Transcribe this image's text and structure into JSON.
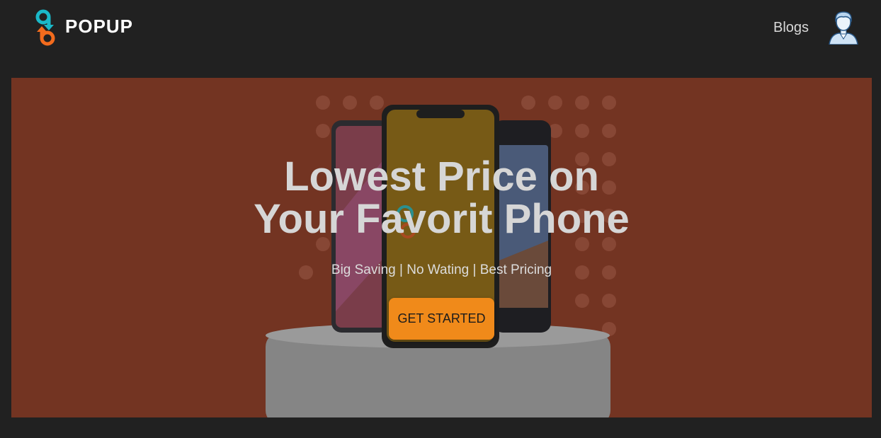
{
  "brand": {
    "name": "POPUP",
    "colors": {
      "primary": "#1ab8c8",
      "secondary": "#f26b1d"
    }
  },
  "nav": {
    "blogs_label": "Blogs",
    "avatar_icon": "user-avatar-icon"
  },
  "hero": {
    "headline_line1": "Lowest Price on",
    "headline_line2": "Your Favorit Phone",
    "subtitle": "Big Saving | No Wating | Best Pricing",
    "cta_label": "GET STARTED",
    "colors": {
      "overlay": "#733422",
      "cta": "#f08a1a"
    }
  }
}
